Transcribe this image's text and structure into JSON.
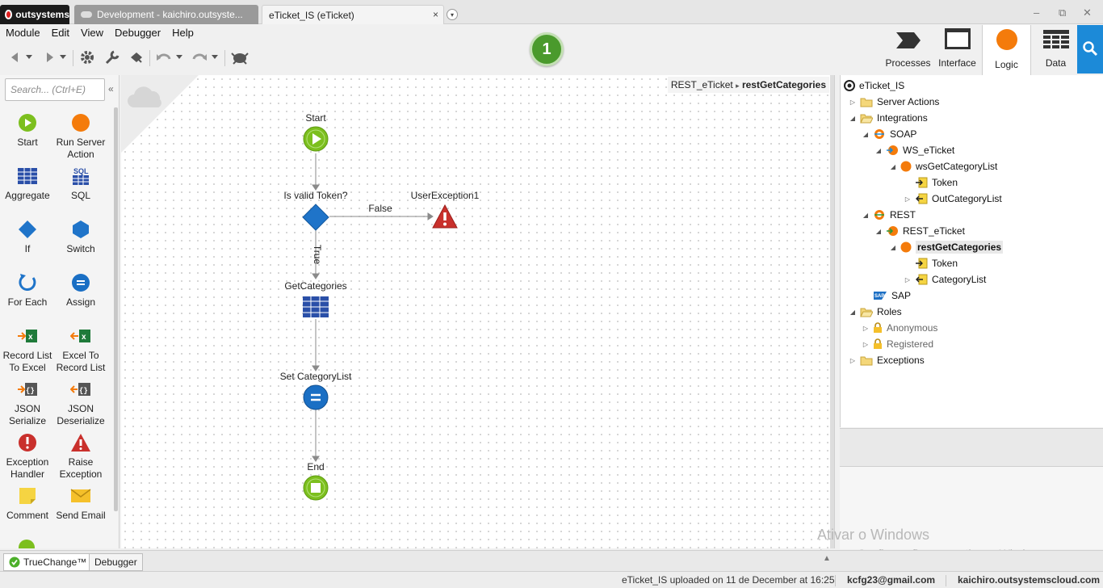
{
  "tabs": {
    "brand": "outsystems",
    "inactive_tab": "Development - kaichiro.outsyste...",
    "active_tab": "eTicket_IS (eTicket)",
    "close": "×",
    "more": "▾"
  },
  "window_controls": {
    "minimize": "–",
    "restore": "⧉",
    "close": "✕"
  },
  "menu": [
    "Module",
    "Edit",
    "View",
    "Debugger",
    "Help"
  ],
  "publish_number": "1",
  "mode_tabs": [
    {
      "label": "Processes",
      "icon": "processes-icon"
    },
    {
      "label": "Interface",
      "icon": "interface-icon"
    },
    {
      "label": "Logic",
      "icon": "logic-icon",
      "active": true
    },
    {
      "label": "Data",
      "icon": "data-icon"
    }
  ],
  "toolbox": {
    "search_placeholder": "Search... (Ctrl+E)",
    "items": [
      {
        "label": "Start",
        "icon": "start-icon"
      },
      {
        "label": "Run Server Action",
        "icon": "run-server-action-icon"
      },
      {
        "label": "Aggregate",
        "icon": "aggregate-icon"
      },
      {
        "label": "SQL",
        "icon": "sql-icon"
      },
      {
        "label": "If",
        "icon": "if-icon"
      },
      {
        "label": "Switch",
        "icon": "switch-icon"
      },
      {
        "label": "For Each",
        "icon": "for-each-icon"
      },
      {
        "label": "Assign",
        "icon": "assign-icon"
      },
      {
        "label": "Record List To Excel",
        "icon": "record-list-to-excel-icon"
      },
      {
        "label": "Excel To Record List",
        "icon": "excel-to-record-list-icon"
      },
      {
        "label": "JSON Serialize",
        "icon": "json-serialize-icon"
      },
      {
        "label": "JSON Deserialize",
        "icon": "json-deserialize-icon"
      },
      {
        "label": "Exception Handler",
        "icon": "exception-handler-icon"
      },
      {
        "label": "Raise Exception",
        "icon": "raise-exception-icon"
      },
      {
        "label": "Comment",
        "icon": "comment-icon"
      },
      {
        "label": "Send Email",
        "icon": "send-email-icon"
      }
    ]
  },
  "breadcrumb": {
    "parent": "REST_eTicket",
    "separator": "▸",
    "current": "restGetCategories"
  },
  "flow": {
    "start": "Start",
    "if_node": "Is valid Token?",
    "false_label": "False",
    "true_label": "True",
    "exception": "UserException1",
    "aggregate": "GetCategories",
    "assign": "Set CategoryList",
    "end": "End"
  },
  "tree": [
    {
      "label": "eTicket_IS",
      "level": 0,
      "icon": "module-icon",
      "arrow": ""
    },
    {
      "label": "Server Actions",
      "level": 1,
      "icon": "folder-icon",
      "arrow": "▷"
    },
    {
      "label": "Integrations",
      "level": 1,
      "icon": "folder-open-icon",
      "arrow": "◢"
    },
    {
      "label": "SOAP",
      "level": 2,
      "icon": "soap-icon",
      "arrow": "◢"
    },
    {
      "label": "WS_eTicket",
      "level": 3,
      "icon": "consumed-service-icon",
      "arrow": "◢"
    },
    {
      "label": "wsGetCategoryList",
      "level": 4,
      "icon": "method-icon",
      "arrow": "◢"
    },
    {
      "label": "Token",
      "level": 5,
      "icon": "input-parameter-icon",
      "arrow": ""
    },
    {
      "label": "OutCategoryList",
      "level": 5,
      "icon": "output-parameter-icon",
      "arrow": "▷"
    },
    {
      "label": "REST",
      "level": 2,
      "icon": "rest-icon",
      "arrow": "◢"
    },
    {
      "label": "REST_eTicket",
      "level": 3,
      "icon": "consumed-service-icon",
      "arrow": "◢"
    },
    {
      "label": "restGetCategories",
      "level": 4,
      "icon": "method-icon",
      "arrow": "◢",
      "selected": true
    },
    {
      "label": "Token",
      "level": 5,
      "icon": "input-parameter-icon",
      "arrow": ""
    },
    {
      "label": "CategoryList",
      "level": 5,
      "icon": "output-parameter-icon",
      "arrow": "▷"
    },
    {
      "label": "SAP",
      "level": 2,
      "icon": "sap-icon",
      "arrow": ""
    },
    {
      "label": "Roles",
      "level": 1,
      "icon": "folder-open-icon",
      "arrow": "◢"
    },
    {
      "label": "Anonymous",
      "level": 2,
      "icon": "lock-icon",
      "arrow": "▷",
      "dim": true
    },
    {
      "label": "Registered",
      "level": 2,
      "icon": "lock-icon",
      "arrow": "▷",
      "dim": true
    },
    {
      "label": "Exceptions",
      "level": 1,
      "icon": "folder-icon",
      "arrow": "▷"
    }
  ],
  "watermark": {
    "line1": "Ativar o Windows",
    "line2": "Acesse Configurações para ativar o Windows."
  },
  "bottom_tabs": [
    "TrueChange™",
    "Debugger"
  ],
  "status": {
    "message": "eTicket_IS uploaded on 11 de December at 16:25",
    "user": "kcfg23@gmail.com",
    "server": "kaichiro.outsystemscloud.com"
  },
  "colors": {
    "start_green": "#7cbf1e",
    "if_blue": "#1f74c9",
    "exception_red": "#c9302c",
    "assign_blue": "#1a6fc4",
    "accent_search": "#1c8ad8",
    "publish_green": "#4a9a2c",
    "logic_orange": "#f47b0b"
  }
}
